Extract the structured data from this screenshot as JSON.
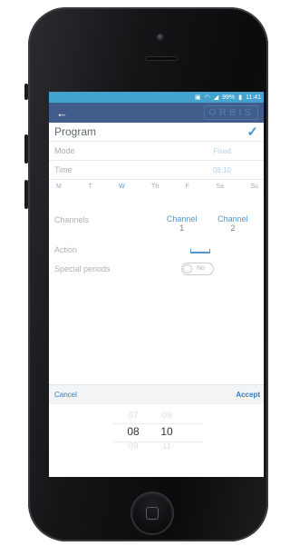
{
  "status_bar": {
    "icons": [
      "sim-icon",
      "wifi-icon",
      "signal-icon",
      "battery-icon"
    ],
    "battery": "99%",
    "time": "11:41"
  },
  "app_bar": {
    "back_icon": "arrow-left-icon",
    "brand": "ORBIS"
  },
  "program": {
    "title": "Program",
    "confirm_icon": "check-icon",
    "mode_label": "Mode",
    "mode_value": "Fixed",
    "time_label": "Time",
    "time_value": "08:10",
    "days": [
      {
        "label": "M",
        "selected": false
      },
      {
        "label": "T",
        "selected": false
      },
      {
        "label": "W",
        "selected": true
      },
      {
        "label": "Th",
        "selected": false
      },
      {
        "label": "F",
        "selected": false
      },
      {
        "label": "Sa",
        "selected": false
      },
      {
        "label": "Su",
        "selected": false
      }
    ],
    "channels_label": "Channels",
    "channels": [
      {
        "name": "Channel",
        "number": "1"
      },
      {
        "name": "Channel",
        "number": "2"
      }
    ],
    "action_label": "Action",
    "special_periods_label": "Special periods",
    "special_periods_value": "No"
  },
  "picker": {
    "cancel_label": "Cancel",
    "accept_label": "Accept",
    "hours": {
      "above": "07",
      "selected": "08",
      "below": "09"
    },
    "minutes": {
      "above": "09",
      "selected": "10",
      "below": "11"
    }
  },
  "colors": {
    "status_bar": "#1c8fc4",
    "app_bar": "#183a73",
    "accent": "#2f7dc8"
  }
}
